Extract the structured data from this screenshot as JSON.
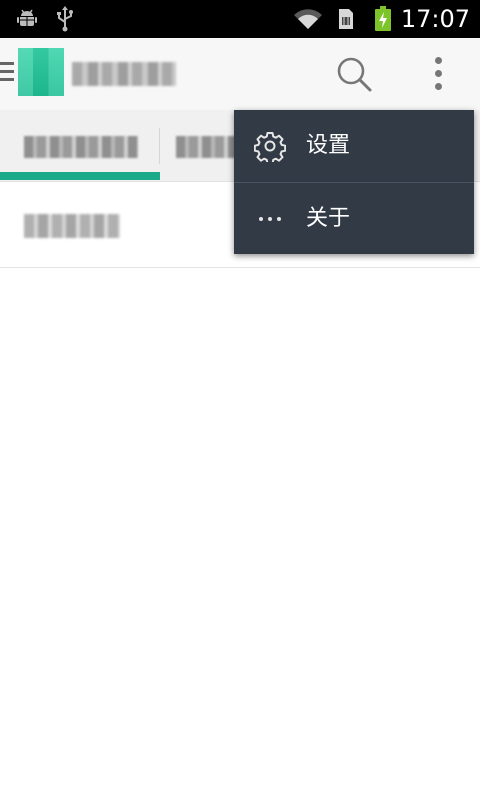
{
  "status_bar": {
    "time": "17:07",
    "left_icons": [
      "android-debug-icon",
      "usb-icon"
    ],
    "right_icons": [
      "wifi-icon",
      "sim-card-icon",
      "battery-charging-icon"
    ],
    "battery_color": "#7cc42a"
  },
  "app_bar": {
    "title": "",
    "icons": [
      "menu-icon",
      "search-icon",
      "more-vert-icon"
    ],
    "accent_color": "#1fbf94"
  },
  "tabs": [
    {
      "label": "",
      "selected": true
    },
    {
      "label": "",
      "selected": false
    }
  ],
  "tab_indicator_color": "#1aaa8a",
  "list": [
    {
      "title": ""
    }
  ],
  "overflow_menu": {
    "background": "#323a45",
    "items": [
      {
        "label": "设置",
        "icon": "gear-icon"
      },
      {
        "label": "关于",
        "icon": "more-horiz-icon"
      }
    ]
  }
}
